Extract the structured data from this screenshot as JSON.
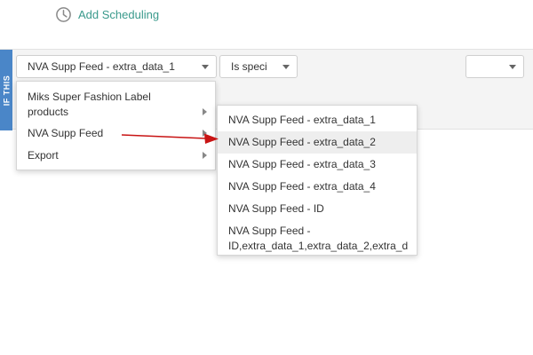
{
  "header": {
    "add_scheduling_label": "Add Scheduling",
    "icon": "clock-icon"
  },
  "rule": {
    "if_label": "IF THIS",
    "field_select_value": "NVA Supp Feed - extra_data_1",
    "operator_select_value": "Is speci",
    "value_select_value": ""
  },
  "menu_level1": {
    "items": [
      {
        "label_line1": "Miks Super Fashion Label",
        "label_line2": "products"
      },
      {
        "label": "NVA Supp Feed"
      },
      {
        "label": "Export"
      }
    ]
  },
  "menu_level2": {
    "items": [
      {
        "label": "NVA Supp Feed - extra_data_1"
      },
      {
        "label": "NVA Supp Feed - extra_data_2",
        "highlighted": true
      },
      {
        "label": "NVA Supp Feed - extra_data_3"
      },
      {
        "label": "NVA Supp Feed - extra_data_4"
      },
      {
        "label": "NVA Supp Feed - ID"
      },
      {
        "label_line1": "NVA Supp Feed -",
        "label_line2": "ID,extra_data_1,extra_data_2,extra_d"
      }
    ]
  },
  "colors": {
    "link": "#3a9a8c",
    "if_tab": "#4a86c8",
    "annotation_arrow": "#c81414"
  }
}
